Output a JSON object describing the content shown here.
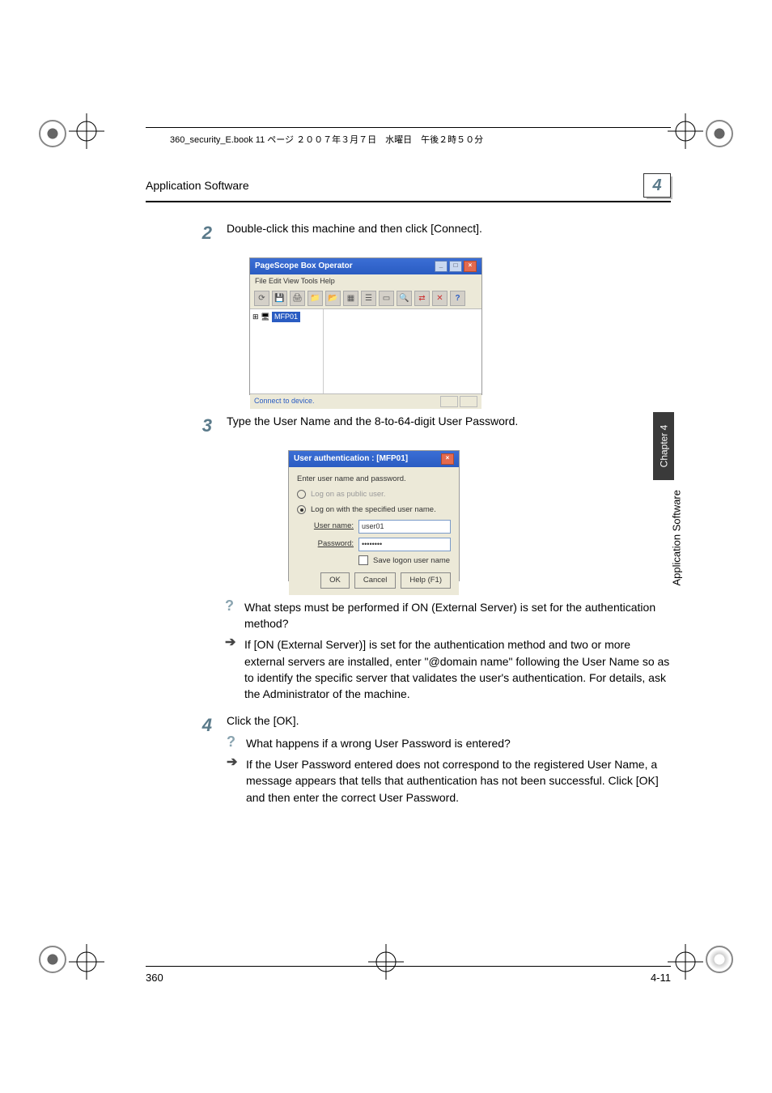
{
  "top_path": "360_security_E.book  11 ページ  ２００７年３月７日　水曜日　午後２時５０分",
  "header": {
    "title": "Application Software",
    "chapter_num": "4"
  },
  "side": {
    "tab": "Chapter 4",
    "label": "Application Software"
  },
  "step2": {
    "num": "2",
    "text": "Double-click this machine and then click [Connect]."
  },
  "shot1": {
    "title": "PageScope Box Operator",
    "menu": "File  Edit  View  Tools  Help",
    "tree_node": "MFP01",
    "status": "Connect to device."
  },
  "step3": {
    "num": "3",
    "text": "Type the User Name and the 8-to-64-digit User Password."
  },
  "shot2": {
    "title": "User authentication : [MFP01]",
    "intro": "Enter user name and password.",
    "opt_public": "Log on as public user.",
    "opt_spec": "Log on with the specified user name.",
    "lbl_user": "User name:",
    "val_user": "user01",
    "lbl_pass": "Password:",
    "val_pass": "••••••••",
    "chk_save": "Save logon user name",
    "btn_ok": "OK",
    "btn_cancel": "Cancel",
    "btn_help": "Help (F1)"
  },
  "qa1": {
    "q": "What steps must be performed if ON (External Server) is set for the authentication method?",
    "a": "If [ON (External Server)] is set for the authentication method and two or more external servers are installed, enter \"@domain name\" following the User Name so as to identify the specific server that validates the user's authentication. For details, ask the Administrator of the machine."
  },
  "step4": {
    "num": "4",
    "text": "Click the [OK]."
  },
  "qa2": {
    "q": "What happens if a wrong User Password is entered?",
    "a": "If the User Password entered does not correspond to the registered User Name, a message appears that tells that authentication has not been successful. Click [OK] and then enter the correct User Password."
  },
  "footer": {
    "left": "360",
    "right": "4-11"
  }
}
